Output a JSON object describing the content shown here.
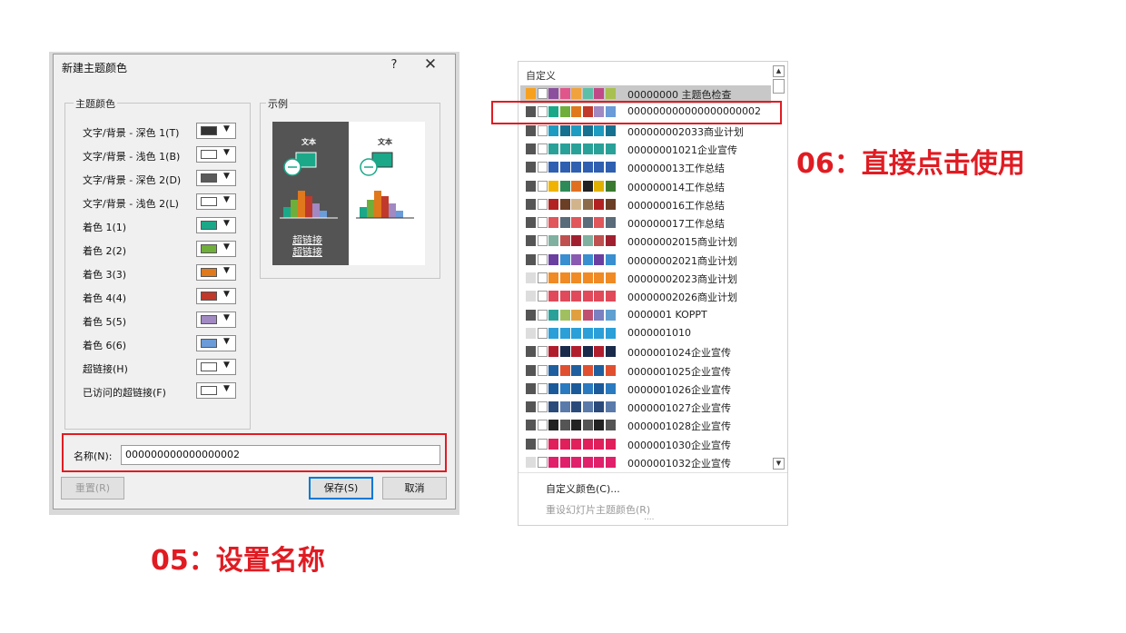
{
  "dialog": {
    "title": "新建主题颜色",
    "help_label": "?",
    "close_label": "✕",
    "theme_group_label": "主题颜色",
    "sample_group_label": "示例",
    "rows": [
      {
        "label": "文字/背景 - 深色 1(T)",
        "color": "#333333"
      },
      {
        "label": "文字/背景 - 浅色 1(B)",
        "color": "#ffffff"
      },
      {
        "label": "文字/背景 - 深色 2(D)",
        "color": "#5a5a5a"
      },
      {
        "label": "文字/背景 - 浅色 2(L)",
        "color": "#ffffff"
      },
      {
        "label": "着色 1(1)",
        "color": "#1ba889"
      },
      {
        "label": "着色 2(2)",
        "color": "#6fae3a"
      },
      {
        "label": "着色 3(3)",
        "color": "#e0781c"
      },
      {
        "label": "着色 4(4)",
        "color": "#c0392b"
      },
      {
        "label": "着色 5(5)",
        "color": "#a189c2"
      },
      {
        "label": "着色 6(6)",
        "color": "#6b9bd8"
      },
      {
        "label": "超链接(H)",
        "color": "#ffffff"
      },
      {
        "label": "已访问的超链接(F)",
        "color": "#ffffff"
      }
    ],
    "sample": {
      "dark_text": "文本",
      "light_text": "文本",
      "hyperlink": "超链接",
      "visited_hyperlink": "超链接"
    },
    "name_label": "名称(N):",
    "name_value": "000000000000000002",
    "reset_label": "重置(R)",
    "save_label": "保存(S)",
    "cancel_label": "取消"
  },
  "panel": {
    "header": "自定义",
    "entries": [
      {
        "name": "00000000 主题色检查",
        "colors": [
          "#f7a01e",
          "#ffffff",
          "#8b4f9e",
          "#e0568a",
          "#f0a23c",
          "#5dbfa8",
          "#c04a87",
          "#a8c050"
        ]
      },
      {
        "name": "000000000000000000002",
        "colors": [
          "#555555",
          "#ffffff",
          "#1ba889",
          "#6fae3a",
          "#e0781c",
          "#c0392b",
          "#a189c2",
          "#6b9bd8"
        ]
      },
      {
        "name": "000000002033商业计划",
        "colors": [
          "#555555",
          "#ffffff",
          "#1e9bc0",
          "#16708f",
          "#1e9bc0",
          "#16708f",
          "#1e9bc0",
          "#16708f"
        ]
      },
      {
        "name": "00000001021企业宣传",
        "colors": [
          "#555555",
          "#ffffff",
          "#2aa198",
          "#2aa198",
          "#2aa198",
          "#2aa198",
          "#2aa198",
          "#2aa198"
        ]
      },
      {
        "name": "000000013工作总结",
        "colors": [
          "#555555",
          "#ffffff",
          "#2f5fb0",
          "#2f5fb0",
          "#2f5fb0",
          "#2f5fb0",
          "#2f5fb0",
          "#2f5fb0"
        ]
      },
      {
        "name": "000000014工作总结",
        "colors": [
          "#555555",
          "#ffffff",
          "#f0b400",
          "#2e8b57",
          "#e07020",
          "#222222",
          "#e0b000",
          "#3a7a30"
        ]
      },
      {
        "name": "000000016工作总结",
        "colors": [
          "#555555",
          "#ffffff",
          "#b22222",
          "#6b3e26",
          "#d2b48c",
          "#8b6b4a",
          "#b22222",
          "#6b3e26"
        ]
      },
      {
        "name": "000000017工作总结",
        "colors": [
          "#555555",
          "#ffffff",
          "#e0565a",
          "#5a6b7a",
          "#e0565a",
          "#5a6b7a",
          "#e0565a",
          "#5a6b7a"
        ]
      },
      {
        "name": "00000002015商业计划",
        "colors": [
          "#555555",
          "#ffffff",
          "#7fb0a0",
          "#c05050",
          "#a02030",
          "#7fb0a0",
          "#c05050",
          "#a02030"
        ]
      },
      {
        "name": "00000002021商业计划",
        "colors": [
          "#555555",
          "#ffffff",
          "#6a3fa0",
          "#3a8fd0",
          "#8a5ab0",
          "#3a8fd0",
          "#6a3fa0",
          "#3a8fd0"
        ]
      },
      {
        "name": "00000002023商业计划",
        "colors": [
          "#dddddd",
          "#ffffff",
          "#f08a24",
          "#f08a24",
          "#f08a24",
          "#f08a24",
          "#f08a24",
          "#f08a24"
        ]
      },
      {
        "name": "00000002026商业计划",
        "colors": [
          "#dddddd",
          "#ffffff",
          "#e04a5a",
          "#e04a5a",
          "#e04a5a",
          "#e04a5a",
          "#e04a5a",
          "#e04a5a"
        ]
      },
      {
        "name": "0000001 KOPPT",
        "colors": [
          "#555555",
          "#ffffff",
          "#2aa198",
          "#a0c060",
          "#e0a040",
          "#c05070",
          "#7a80c0",
          "#60a0d0"
        ]
      },
      {
        "name": "0000001010",
        "colors": [
          "#dddddd",
          "#ffffff",
          "#2a9fd8",
          "#2a9fd8",
          "#2a9fd8",
          "#2a9fd8",
          "#2a9fd8",
          "#2a9fd8"
        ]
      },
      {
        "name": "0000001024企业宣传",
        "colors": [
          "#555555",
          "#ffffff",
          "#b01e2e",
          "#1a2a4a",
          "#b01e2e",
          "#1a2a4a",
          "#b01e2e",
          "#1a2a4a"
        ]
      },
      {
        "name": "0000001025企业宣传",
        "colors": [
          "#555555",
          "#ffffff",
          "#1f5f9f",
          "#e05030",
          "#1f5f9f",
          "#e05030",
          "#1f5f9f",
          "#e05030"
        ]
      },
      {
        "name": "0000001026企业宣传",
        "colors": [
          "#555555",
          "#ffffff",
          "#1a5a9a",
          "#2a7ac0",
          "#1a5a9a",
          "#2a7ac0",
          "#1a5a9a",
          "#2a7ac0"
        ]
      },
      {
        "name": "0000001027企业宣传",
        "colors": [
          "#555555",
          "#ffffff",
          "#2a4a7a",
          "#5a7aaa",
          "#2a4a7a",
          "#5a7aaa",
          "#2a4a7a",
          "#5a7aaa"
        ]
      },
      {
        "name": "0000001028企业宣传",
        "colors": [
          "#555555",
          "#ffffff",
          "#222222",
          "#555555",
          "#222222",
          "#555555",
          "#222222",
          "#555555"
        ]
      },
      {
        "name": "0000001030企业宣传",
        "colors": [
          "#555555",
          "#ffffff",
          "#e0205a",
          "#e0205a",
          "#e0205a",
          "#e0205a",
          "#e0205a",
          "#e0205a"
        ]
      },
      {
        "name": "0000001032企业宣传",
        "colors": [
          "#dddddd",
          "#ffffff",
          "#e0206a",
          "#e0206a",
          "#e0206a",
          "#e0206a",
          "#e0206a",
          "#e0206a"
        ]
      }
    ],
    "custom_colors_label": "自定义颜色(C)...",
    "reset_slide_colors_label": "重设幻灯片主题颜色(R)",
    "more_dots": "....",
    "scroll_up": "▲",
    "scroll_down": "▼"
  },
  "annotations": {
    "step5": "05：设置名称",
    "step6": "06：直接点击使用"
  },
  "colors": {
    "accent_red": "#e01c23",
    "sample_dark_bg": "#545454"
  }
}
